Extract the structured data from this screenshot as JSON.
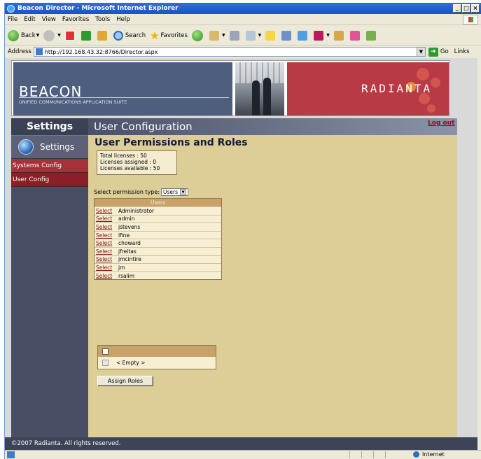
{
  "window": {
    "title": "Beacon Director - Microsoft Internet Explorer",
    "controls": [
      "_",
      "□",
      "×"
    ]
  },
  "menu": [
    "File",
    "Edit",
    "View",
    "Favorites",
    "Tools",
    "Help"
  ],
  "toolbar": {
    "back": "Back",
    "search": "Search",
    "favorites": "Favorites"
  },
  "address": {
    "label": "Address",
    "url": "http://192.168.43.32:8766/Director.aspx",
    "go": "Go",
    "links": "Links"
  },
  "banner": {
    "brand": "BEACON",
    "tagline": "UNIFIED COMMUNICATIONS APPLICATION SUITE",
    "partner": "RADIANTA"
  },
  "sidebar": {
    "header": "Settings",
    "section": "Settings",
    "items": [
      {
        "label": "Systems Config"
      },
      {
        "label": "User Config"
      }
    ]
  },
  "page": {
    "header": "User Configuration",
    "logout": "Log out",
    "title": "User Permissions and Roles"
  },
  "licenses": {
    "total": "Total licenses : 50",
    "assigned": "Licenses assigned : 0",
    "available": "Licenses available : 50"
  },
  "permission": {
    "label": "Select permission type:",
    "selected": "Users"
  },
  "users_table": {
    "header": "Users",
    "select_label": "Select",
    "rows": [
      "Administrator",
      "admin",
      "jstevens",
      "lfine",
      "choward",
      "jfreitas",
      "jmcintire",
      "jm",
      "rsalim"
    ]
  },
  "roles_table": {
    "empty_text": "< Empty >"
  },
  "assign_button": "Assign Roles",
  "footer": "©2007 Radianta. All rights reserved.",
  "status": {
    "zone": "Internet"
  },
  "colors": {
    "content_bg": "#ddcd97",
    "sidebar_bg": "#484e63",
    "accent_red": "#a5323b",
    "table_header": "#c9a26a"
  }
}
